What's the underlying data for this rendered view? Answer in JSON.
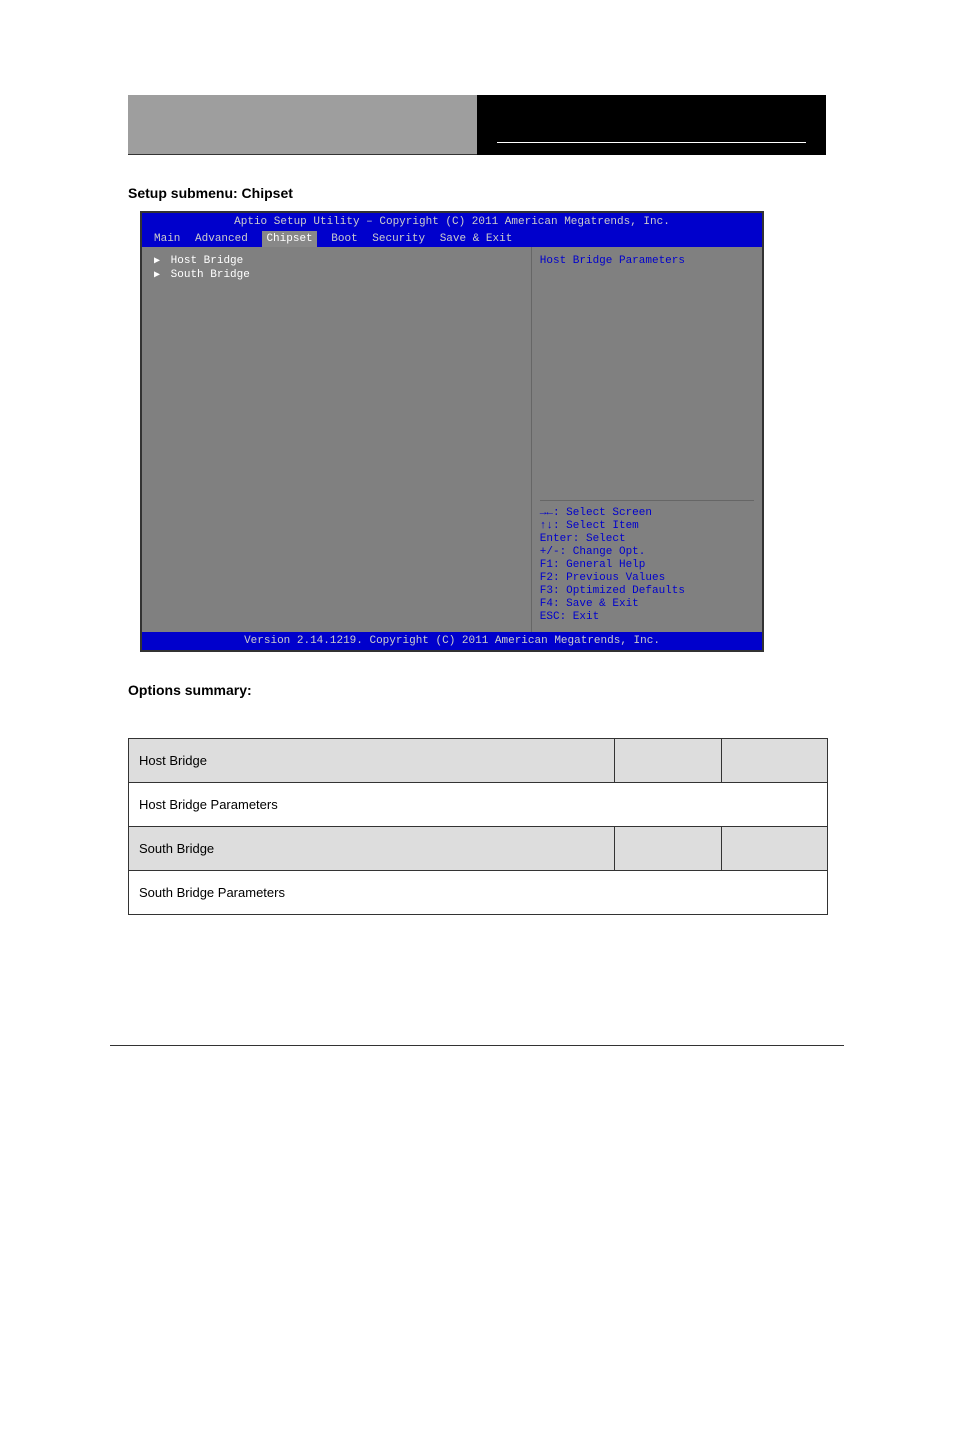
{
  "header": {},
  "section": {
    "title": "Setup submenu: Chipset"
  },
  "bios": {
    "title": "Aptio Setup Utility – Copyright (C) 2011 American Megatrends, Inc.",
    "menu": {
      "items": [
        "Main",
        "Advanced",
        "Chipset",
        "Boot",
        "Security",
        "Save & Exit"
      ],
      "active": "Chipset"
    },
    "left_items": [
      {
        "label": "Host Bridge"
      },
      {
        "label": "South Bridge"
      }
    ],
    "help_description": "Host Bridge Parameters",
    "help_keys": [
      "→←: Select Screen",
      "↑↓: Select Item",
      "Enter: Select",
      "+/-: Change Opt.",
      "F1: General Help",
      "F2: Previous Values",
      "F3: Optimized Defaults",
      "F4: Save & Exit",
      "ESC: Exit"
    ],
    "footer": "Version 2.14.1219. Copyright (C) 2011 American Megatrends, Inc."
  },
  "table": {
    "rows": [
      {
        "c1": "Host Bridge",
        "c2": "",
        "c3": "",
        "shaded": true
      },
      {
        "c1": "Host Bridge Parameters",
        "span": true,
        "shaded": false
      },
      {
        "c1": "South Bridge",
        "c2": "",
        "c3": "",
        "shaded": true
      },
      {
        "c1": "South Bridge Parameters",
        "span": true,
        "shaded": false
      }
    ]
  }
}
